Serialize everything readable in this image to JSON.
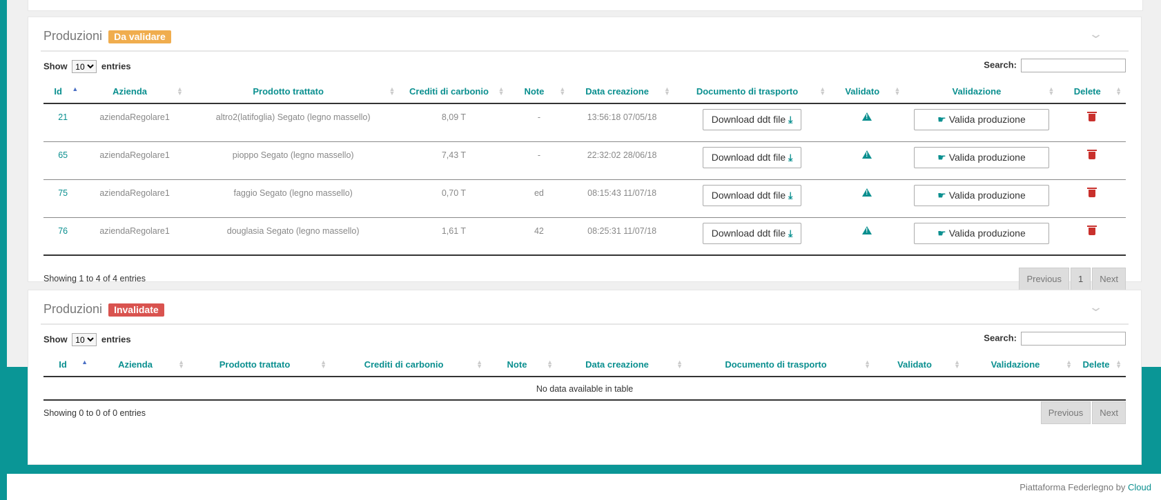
{
  "panel1": {
    "title": "Produzioni",
    "badge": "Da validare",
    "show_label": "Show",
    "length": "10",
    "entries_label": "entries",
    "search_label": "Search:",
    "search_value": "",
    "columns": [
      "Id",
      "Azienda",
      "Prodotto trattato",
      "Crediti di carbonio",
      "Note",
      "Data creazione",
      "Documento di trasporto",
      "Validato",
      "Validazione",
      "Delete"
    ],
    "rows": [
      {
        "id": "21",
        "azienda": "aziendaRegolare1",
        "prodotto": "altro2(latifoglia) Segato (legno massello)",
        "crediti": "8,09 T",
        "note": "-",
        "data": "13:56:18 07/05/18",
        "download": "Download ddt file",
        "valida": "Valida produzione"
      },
      {
        "id": "65",
        "azienda": "aziendaRegolare1",
        "prodotto": "pioppo Segato (legno massello)",
        "crediti": "7,43 T",
        "note": "-",
        "data": "22:32:02 28/06/18",
        "download": "Download ddt file",
        "valida": "Valida produzione"
      },
      {
        "id": "75",
        "azienda": "aziendaRegolare1",
        "prodotto": "faggio Segato (legno massello)",
        "crediti": "0,70 T",
        "note": "ed",
        "data": "08:15:43 11/07/18",
        "download": "Download ddt file",
        "valida": "Valida produzione"
      },
      {
        "id": "76",
        "azienda": "aziendaRegolare1",
        "prodotto": "douglasia Segato (legno massello)",
        "crediti": "1,61 T",
        "note": "42",
        "data": "08:25:31 11/07/18",
        "download": "Download ddt file",
        "valida": "Valida produzione"
      }
    ],
    "info": "Showing 1 to 4 of 4 entries",
    "prev": "Previous",
    "page": "1",
    "next": "Next"
  },
  "panel2": {
    "title": "Produzioni",
    "badge": "Invalidate",
    "show_label": "Show",
    "length": "10",
    "entries_label": "entries",
    "search_label": "Search:",
    "search_value": "",
    "columns": [
      "Id",
      "Azienda",
      "Prodotto trattato",
      "Crediti di carbonio",
      "Note",
      "Data creazione",
      "Documento di trasporto",
      "Validato",
      "Validazione",
      "Delete"
    ],
    "empty": "No data available in table",
    "info": "Showing 0 to 0 of 0 entries",
    "prev": "Previous",
    "next": "Next"
  },
  "footer": {
    "text": "Piattaforma Federlegno by ",
    "link": "Cloud"
  },
  "colors": {
    "teal": "#0a9696",
    "orange": "#f0ad4e",
    "red": "#d9534f"
  },
  "icons": {
    "collapse": "chevron-down-icon",
    "download": "download-icon",
    "validate": "hand-point-icon",
    "validated": "warning-icon",
    "delete": "trash-icon"
  }
}
